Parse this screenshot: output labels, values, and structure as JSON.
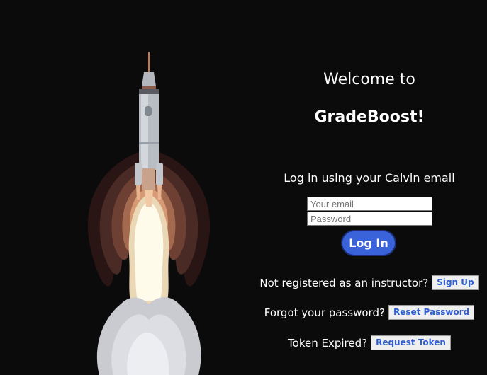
{
  "header": {
    "welcome": "Welcome to",
    "brand": "GradeBoost!"
  },
  "login": {
    "hint": "Log in using your Calvin email",
    "email_placeholder": "Your email",
    "password_placeholder": "Password",
    "button_label": "Log In"
  },
  "links": {
    "register_text": "Not registered as an instructor?",
    "register_button": "Sign Up",
    "forgot_text": "Forgot your password?",
    "forgot_button": "Reset Password",
    "token_text": "Token Expired?",
    "token_button": "Request Token"
  },
  "colors": {
    "background": "#0b0b0b",
    "primary_button": "#3b63d9",
    "link_button_text": "#2f5fcf"
  },
  "illustration": {
    "icon": "rocket-launch-illustration"
  }
}
